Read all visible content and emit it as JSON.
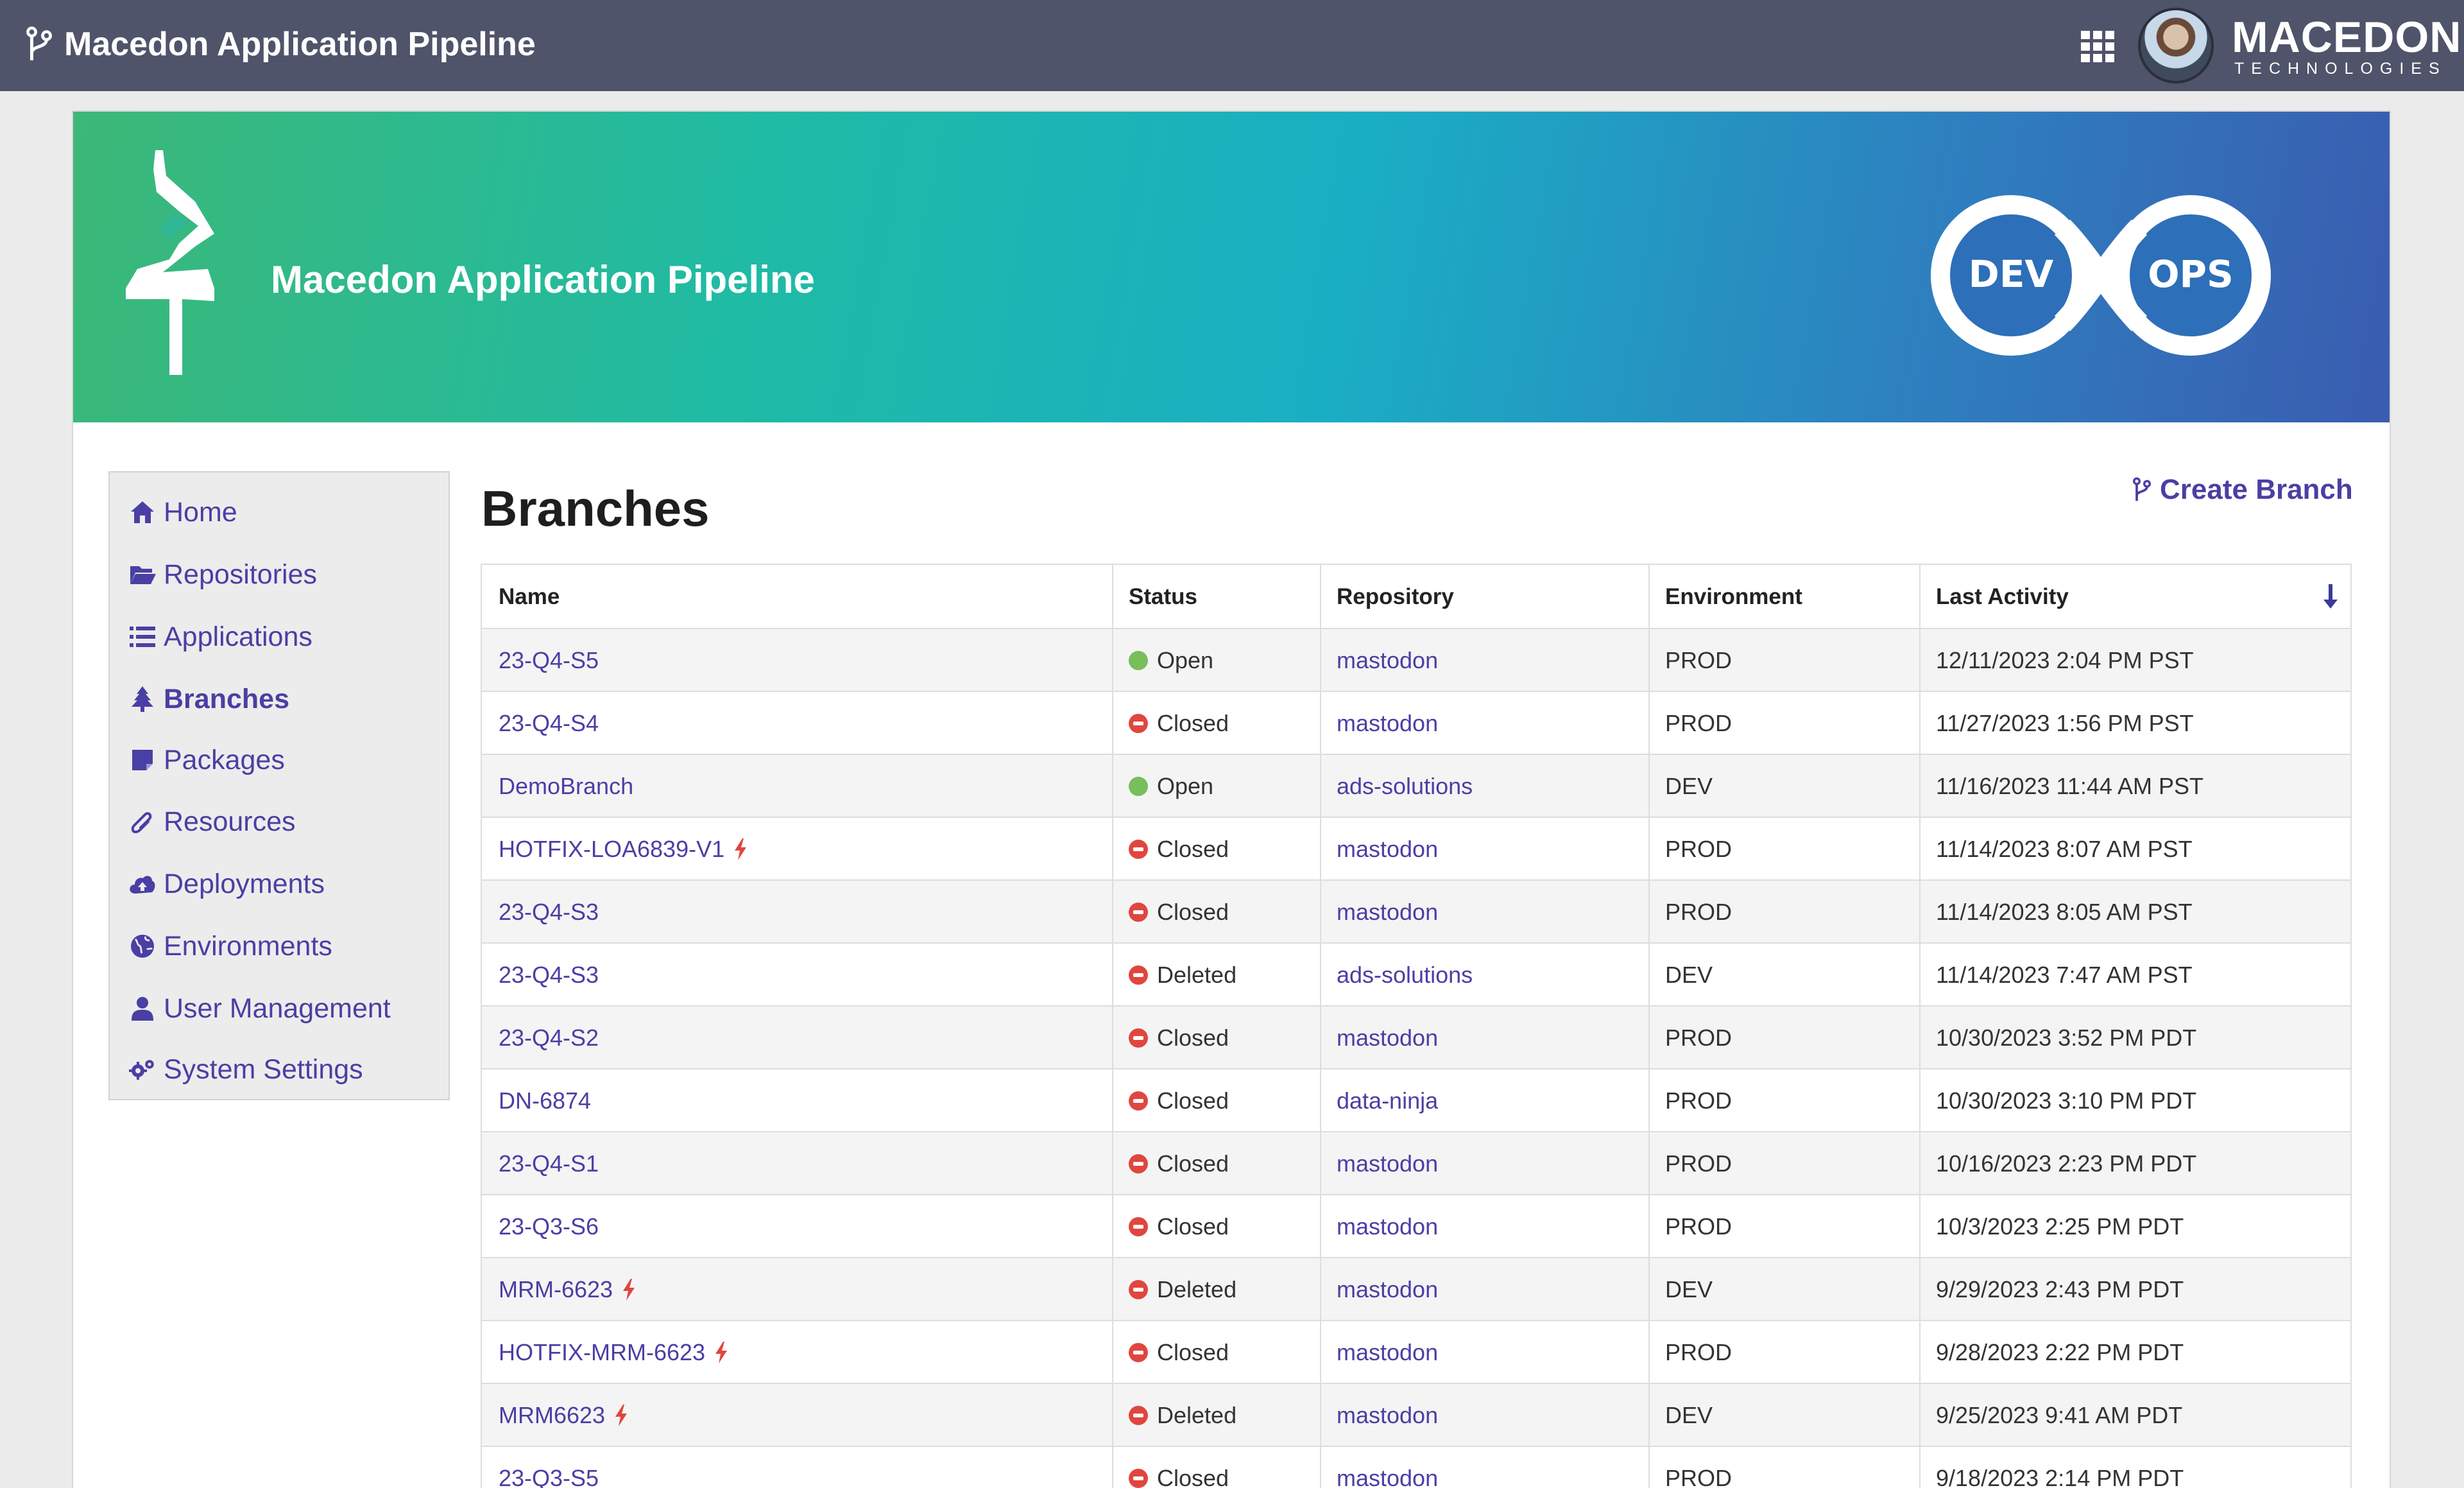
{
  "topbar": {
    "title": "Macedon Application Pipeline",
    "brand_name": "MACEDON",
    "brand_sub": "TECHNOLOGIES"
  },
  "banner": {
    "title": "Macedon Application Pipeline",
    "devops_left": "DEV",
    "devops_right": "OPS"
  },
  "sidebar": {
    "items": [
      {
        "label": "Home",
        "icon": "home-icon"
      },
      {
        "label": "Repositories",
        "icon": "folder-open-icon"
      },
      {
        "label": "Applications",
        "icon": "list-icon"
      },
      {
        "label": "Branches",
        "icon": "tree-icon",
        "active": true
      },
      {
        "label": "Packages",
        "icon": "package-icon"
      },
      {
        "label": "Resources",
        "icon": "paperclip-icon"
      },
      {
        "label": "Deployments",
        "icon": "cloud-upload-icon"
      },
      {
        "label": "Environments",
        "icon": "globe-icon"
      },
      {
        "label": "User Management",
        "icon": "user-icon"
      },
      {
        "label": "System Settings",
        "icon": "gears-icon"
      }
    ]
  },
  "main": {
    "page_title": "Branches",
    "create_branch_label": "Create Branch"
  },
  "table": {
    "columns": [
      "Name",
      "Status",
      "Repository",
      "Environment",
      "Last Activity"
    ],
    "rows": [
      {
        "name": "23-Q4-S5",
        "status": "Open",
        "repository": "mastodon",
        "environment": "PROD",
        "last_activity": "12/11/2023 2:04 PM PST",
        "hotfix": false
      },
      {
        "name": "23-Q4-S4",
        "status": "Closed",
        "repository": "mastodon",
        "environment": "PROD",
        "last_activity": "11/27/2023 1:56 PM PST",
        "hotfix": false
      },
      {
        "name": "DemoBranch",
        "status": "Open",
        "repository": "ads-solutions",
        "environment": "DEV",
        "last_activity": "11/16/2023 11:44 AM PST",
        "hotfix": false
      },
      {
        "name": "HOTFIX-LOA6839-V1",
        "status": "Closed",
        "repository": "mastodon",
        "environment": "PROD",
        "last_activity": "11/14/2023 8:07 AM PST",
        "hotfix": true
      },
      {
        "name": "23-Q4-S3",
        "status": "Closed",
        "repository": "mastodon",
        "environment": "PROD",
        "last_activity": "11/14/2023 8:05 AM PST",
        "hotfix": false
      },
      {
        "name": "23-Q4-S3",
        "status": "Deleted",
        "repository": "ads-solutions",
        "environment": "DEV",
        "last_activity": "11/14/2023 7:47 AM PST",
        "hotfix": false
      },
      {
        "name": "23-Q4-S2",
        "status": "Closed",
        "repository": "mastodon",
        "environment": "PROD",
        "last_activity": "10/30/2023 3:52 PM PDT",
        "hotfix": false
      },
      {
        "name": "DN-6874",
        "status": "Closed",
        "repository": "data-ninja",
        "environment": "PROD",
        "last_activity": "10/30/2023 3:10 PM PDT",
        "hotfix": false
      },
      {
        "name": "23-Q4-S1",
        "status": "Closed",
        "repository": "mastodon",
        "environment": "PROD",
        "last_activity": "10/16/2023 2:23 PM PDT",
        "hotfix": false
      },
      {
        "name": "23-Q3-S6",
        "status": "Closed",
        "repository": "mastodon",
        "environment": "PROD",
        "last_activity": "10/3/2023 2:25 PM PDT",
        "hotfix": false
      },
      {
        "name": "MRM-6623",
        "status": "Deleted",
        "repository": "mastodon",
        "environment": "DEV",
        "last_activity": "9/29/2023 2:43 PM PDT",
        "hotfix": true
      },
      {
        "name": "HOTFIX-MRM-6623",
        "status": "Closed",
        "repository": "mastodon",
        "environment": "PROD",
        "last_activity": "9/28/2023 2:22 PM PDT",
        "hotfix": true
      },
      {
        "name": "MRM6623",
        "status": "Deleted",
        "repository": "mastodon",
        "environment": "DEV",
        "last_activity": "9/25/2023 9:41 AM PDT",
        "hotfix": true
      },
      {
        "name": "23-Q3-S5",
        "status": "Closed",
        "repository": "mastodon",
        "environment": "PROD",
        "last_activity": "9/18/2023 2:14 PM PDT",
        "hotfix": false
      }
    ]
  },
  "colors": {
    "topbar": "#4f546a",
    "link": "#4a3fa4",
    "status_open": "#78be5a",
    "status_closed": "#e0463f",
    "hotfix_bolt": "#e0463f"
  }
}
